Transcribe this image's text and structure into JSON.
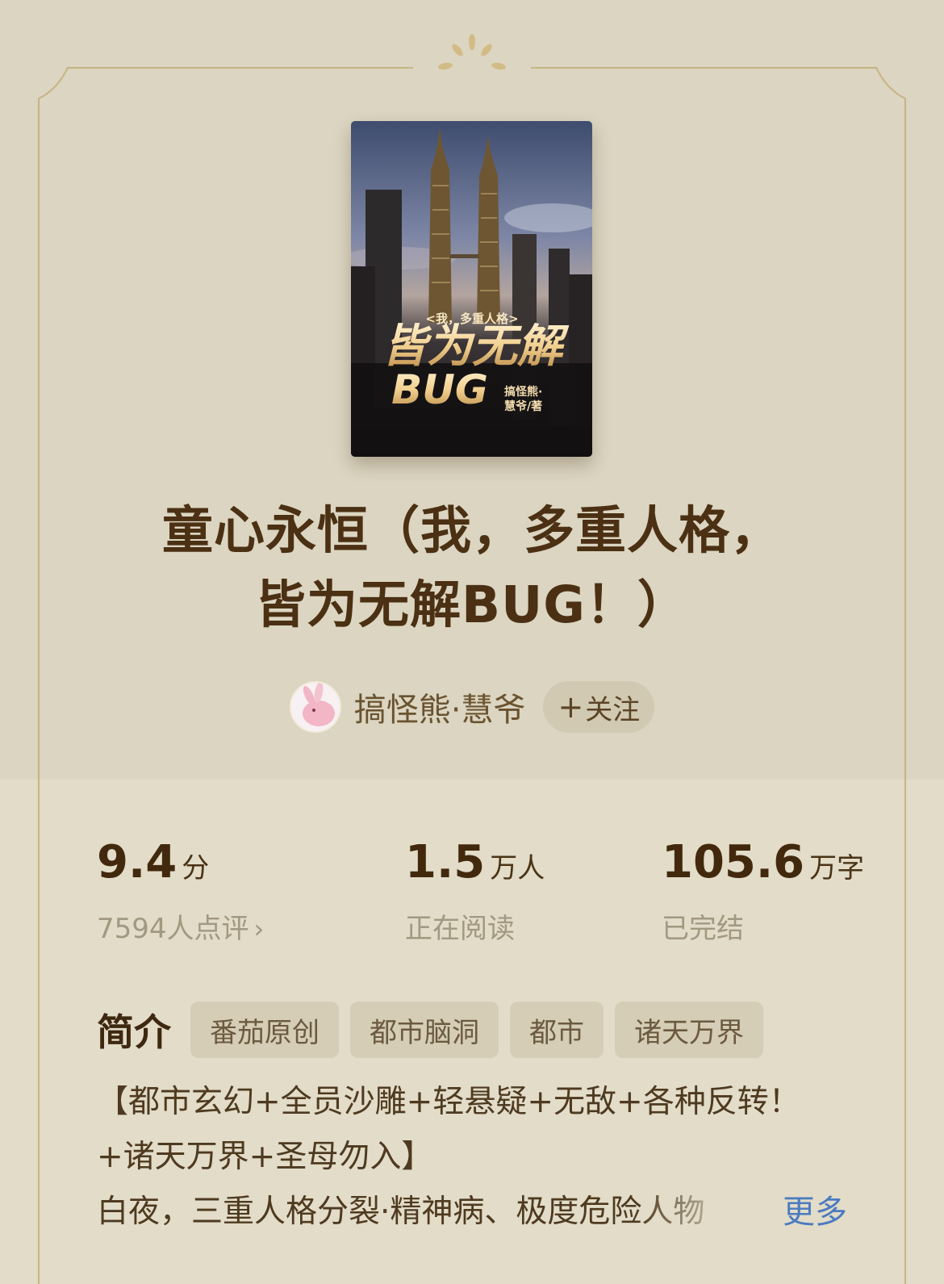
{
  "book": {
    "cover": {
      "series_label": "<我，多重人格>",
      "title_art": "皆为无解",
      "title_art_bug": "BUG",
      "author_art_line1": "搞怪熊·",
      "author_art_line2": "慧爷/著"
    },
    "title_line1": "童心永恒（我，多重人格，",
    "title_line2": "皆为无解BUG！）",
    "author": {
      "name": "搞怪熊·慧爷",
      "follow_label": "关注",
      "follow_plus": "+"
    }
  },
  "stats": {
    "rating": {
      "value": "9.4",
      "unit": "分",
      "sub": "7594人点评",
      "chevron": "›"
    },
    "readers": {
      "value": "1.5",
      "unit": "万人",
      "sub": "正在阅读"
    },
    "words": {
      "value": "105.6",
      "unit": "万字",
      "sub": "已完结"
    }
  },
  "intro": {
    "label": "简介",
    "tags": [
      "番茄原创",
      "都市脑洞",
      "都市",
      "诸天万界"
    ],
    "desc_line1": "【都市玄幻+全员沙雕+轻悬疑+无敌+各种反转！",
    "desc_line2": "+诸天万界+圣母勿入】",
    "desc_line3": "白夜，三重人格分裂·精神病、极度危险人物",
    "more_label": "更多"
  },
  "colors": {
    "background": "#dbd5c1",
    "lower_background": "#e2dcc8",
    "title": "#4b3013",
    "tag_bg": "#d5cdb6",
    "more_link": "#4b7bc0",
    "frame_gold": "#c8b07c"
  }
}
